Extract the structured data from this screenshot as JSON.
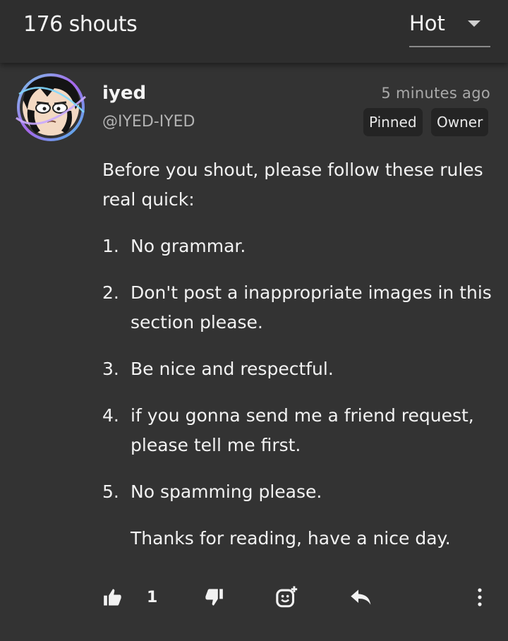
{
  "header": {
    "shout_count": "176 shouts",
    "sort_label": "Hot"
  },
  "post": {
    "author_name": "iyed",
    "author_handle": "@IYED-IYED",
    "timestamp": "5 minutes ago",
    "badges": [
      "Pinned",
      "Owner"
    ],
    "intro": "Before you shout, please follow these rules real quick:",
    "rules": [
      {
        "num": "1.",
        "text": "No grammar."
      },
      {
        "num": "2.",
        "text": "Don't post a inappropriate images in this section please."
      },
      {
        "num": "3.",
        "text": "Be nice and respectful."
      },
      {
        "num": "4.",
        "text": "if you gonna send me a friend request, please tell me first."
      },
      {
        "num": "5.",
        "text": "No spamming please."
      }
    ],
    "outro": "Thanks for reading, have a nice day."
  },
  "actions": {
    "like_count": "1",
    "icons": [
      "thumbs-up-icon",
      "thumbs-down-icon",
      "add-reaction-icon",
      "reply-icon",
      "more-vertical-icon"
    ]
  },
  "colors": {
    "background": "#333333",
    "header_background": "#2e2e2e",
    "badge_background": "#242424",
    "muted_text": "#a9a9a9"
  }
}
